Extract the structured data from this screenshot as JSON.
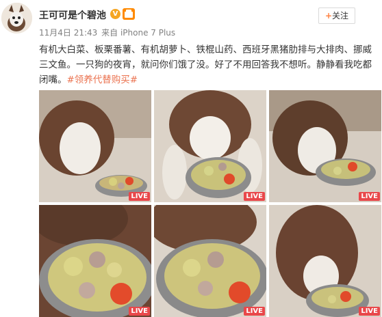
{
  "post": {
    "username": "王可可是个碧池",
    "verified_badge": "V",
    "date": "11月4日 21:43",
    "source": "来自 iPhone 7 Plus",
    "follow_label": "关注",
    "follow_plus": "+",
    "text": "有机大白菜、板栗番薯、有机胡萝卜、铁棍山药、西班牙黑猪肋排与大排肉、挪威三文鱼。一只狗的夜宵，就问你们饿了没。好了不用回答我不想听。静静看我吃都闭嘴。",
    "hashtag": "#领养代替购买#"
  },
  "photos": [
    {
      "live_label": "LIVE"
    },
    {
      "live_label": "LIVE"
    },
    {
      "live_label": "LIVE"
    },
    {
      "live_label": "LIVE"
    },
    {
      "live_label": "LIVE"
    },
    {
      "live_label": "LIVE"
    }
  ],
  "colors": {
    "hashtag": "#eb7350",
    "live_badge": "#e9474a",
    "verified": "#f5a623",
    "text": "#333333",
    "meta": "#808080"
  }
}
